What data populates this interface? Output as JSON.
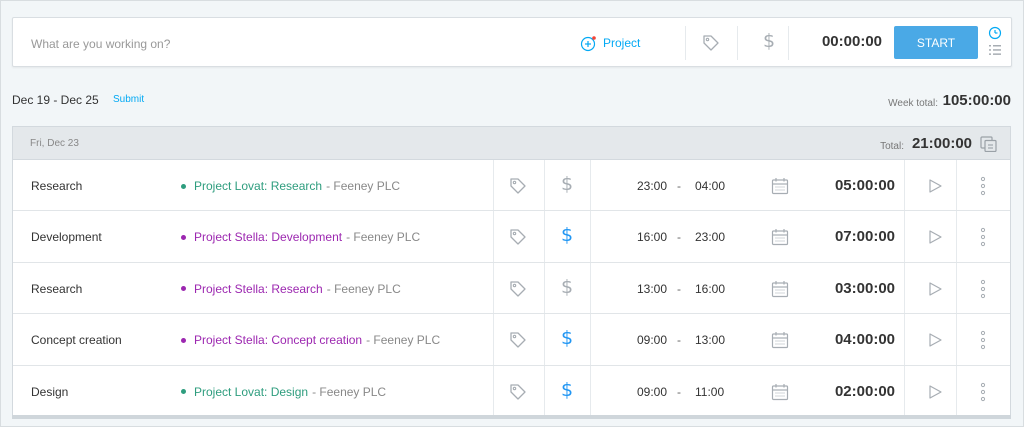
{
  "tracker": {
    "placeholder": "What are you working on?",
    "project_label": "Project",
    "time": "00:00:00",
    "start_label": "START"
  },
  "week": {
    "range": "Dec 19 - Dec 25",
    "submit_label": "Submit",
    "total_label": "Week total:",
    "total_value": "105:00:00"
  },
  "day": {
    "date": "Fri, Dec 23",
    "total_label": "Total:",
    "total_value": "21:00:00"
  },
  "entries": [
    {
      "description": "Research",
      "project": "Project Lovat: Research",
      "client": "Feeney PLC",
      "project_color": "#2e9d7e",
      "billable": false,
      "start": "23:00",
      "end": "04:00",
      "duration": "05:00:00"
    },
    {
      "description": "Development",
      "project": "Project Stella: Development",
      "client": "Feeney PLC",
      "project_color": "#9c27b0",
      "billable": true,
      "start": "16:00",
      "end": "23:00",
      "duration": "07:00:00"
    },
    {
      "description": "Research",
      "project": "Project Stella: Research",
      "client": "Feeney PLC",
      "project_color": "#9c27b0",
      "billable": false,
      "start": "13:00",
      "end": "16:00",
      "duration": "03:00:00"
    },
    {
      "description": "Concept creation",
      "project": "Project Stella: Concept creation",
      "client": "Feeney PLC",
      "project_color": "#9c27b0",
      "billable": true,
      "start": "09:00",
      "end": "13:00",
      "duration": "04:00:00"
    },
    {
      "description": "Design",
      "project": "Project Lovat: Design",
      "client": "Feeney PLC",
      "project_color": "#2e9d7e",
      "billable": true,
      "start": "09:00",
      "end": "11:00",
      "duration": "02:00:00"
    }
  ],
  "colors": {
    "accent": "#03a9f4",
    "start_button": "#4aa9e6",
    "billable_on": "#2196f3",
    "billable_off": "#a7adb3",
    "icon_gray": "#a7adb3"
  },
  "icons": {
    "project": "plus-circle-icon",
    "tag": "tag-icon",
    "billable": "dollar-icon",
    "mode_timer": "clock-icon",
    "mode_manual": "list-icon",
    "calendar": "calendar-icon",
    "play": "play-icon",
    "more": "more-vertical-icon",
    "copy": "duplicate-icon"
  }
}
